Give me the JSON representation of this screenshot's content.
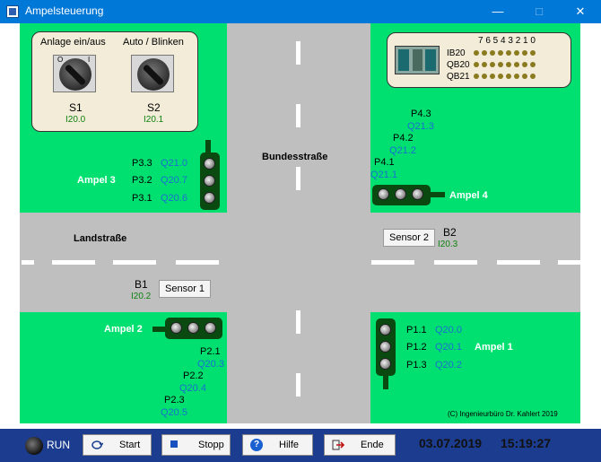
{
  "window": {
    "title": "Ampelsteuerung",
    "controls": [
      "—",
      "□",
      "✕"
    ]
  },
  "panel_left": {
    "s1_title": "Anlage ein/aus",
    "s2_title": "Auto / Blinken",
    "s1_name": "S1",
    "s1_addr": "I20.0",
    "s2_name": "S2",
    "s2_addr": "I20.1",
    "s1_off": "O",
    "s1_on": "I"
  },
  "plc": {
    "bits_header": "7 6 5 4 3 2 1 0",
    "rows": [
      "IB20",
      "QB20",
      "QB21"
    ]
  },
  "roads": {
    "bundesstrasse": "Bundesstraße",
    "landstrasse": "Landstraße"
  },
  "ampel3": {
    "name": "Ampel 3",
    "lamps": [
      {
        "p": "P3.3",
        "q": "Q21.0"
      },
      {
        "p": "P3.2",
        "q": "Q20.7"
      },
      {
        "p": "P3.1",
        "q": "Q20.6"
      }
    ]
  },
  "ampel4": {
    "name": "Ampel 4",
    "lamps": [
      {
        "p": "P4.3",
        "q": "Q21.3"
      },
      {
        "p": "P4.2",
        "q": "Q21.2"
      },
      {
        "p": "P4.1",
        "q": "Q21.1"
      }
    ]
  },
  "ampel2": {
    "name": "Ampel 2",
    "lamps": [
      {
        "p": "P2.1",
        "q": "Q20.3"
      },
      {
        "p": "P2.2",
        "q": "Q20.4"
      },
      {
        "p": "P2.3",
        "q": "Q20.5"
      }
    ]
  },
  "ampel1": {
    "name": "Ampel 1",
    "lamps": [
      {
        "p": "P1.1",
        "q": "Q20.0"
      },
      {
        "p": "P1.2",
        "q": "Q20.1"
      },
      {
        "p": "P1.3",
        "q": "Q20.2"
      }
    ]
  },
  "sensors": {
    "b1": {
      "name": "B1",
      "addr": "I20.2",
      "button": "Sensor 1"
    },
    "b2": {
      "name": "B2",
      "addr": "I20.3",
      "button": "Sensor 2"
    }
  },
  "copyright": "(C) Ingenieurbüro Dr. Kahlert 2019",
  "bottom": {
    "run": "RUN",
    "start": "Start",
    "stopp": "Stopp",
    "hilfe": "Hilfe",
    "ende": "Ende",
    "date": "03.07.2019",
    "time": "15:19:27"
  },
  "colors": {
    "grass": "#00e070",
    "road": "#bfbfbf",
    "titlebar": "#0078d7",
    "bottombar": "#1c3d8f"
  }
}
